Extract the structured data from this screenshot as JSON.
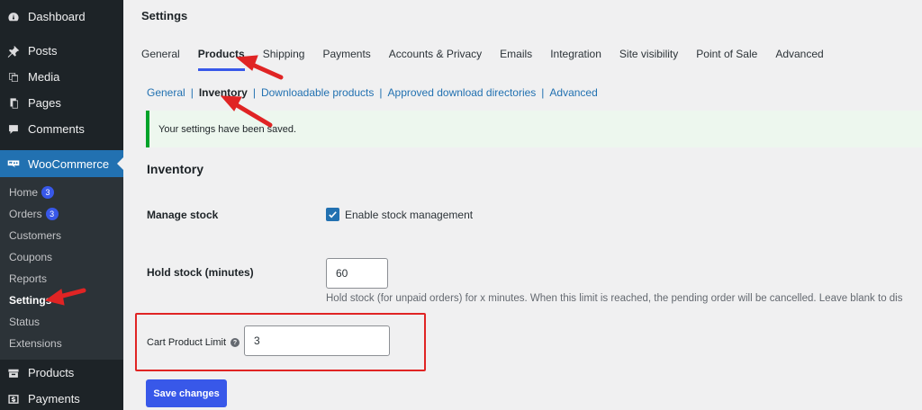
{
  "sidebar": {
    "top_items": [
      {
        "label": "Dashboard",
        "icon": "dashboard-icon"
      },
      {
        "label": "Posts",
        "icon": "pin-icon"
      },
      {
        "label": "Media",
        "icon": "media-icon"
      },
      {
        "label": "Pages",
        "icon": "pages-icon"
      },
      {
        "label": "Comments",
        "icon": "comments-icon"
      }
    ],
    "woocommerce": {
      "label": "WooCommerce",
      "icon": "woocommerce-icon"
    },
    "submenu": [
      {
        "label": "Home",
        "badge": "3"
      },
      {
        "label": "Orders",
        "badge": "3"
      },
      {
        "label": "Customers"
      },
      {
        "label": "Coupons"
      },
      {
        "label": "Reports"
      },
      {
        "label": "Settings",
        "current": true
      },
      {
        "label": "Status"
      },
      {
        "label": "Extensions"
      }
    ],
    "bottom_items": [
      {
        "label": "Products",
        "icon": "products-icon"
      },
      {
        "label": "Payments",
        "icon": "payments-icon"
      }
    ]
  },
  "header": {
    "title": "Settings"
  },
  "tabs": [
    "General",
    "Products",
    "Shipping",
    "Payments",
    "Accounts & Privacy",
    "Emails",
    "Integration",
    "Site visibility",
    "Point of Sale",
    "Advanced"
  ],
  "active_tab": "Products",
  "subnav": {
    "items": [
      "General",
      "Inventory",
      "Downloadable products",
      "Approved download directories",
      "Advanced"
    ],
    "current": "Inventory",
    "separator": "|"
  },
  "notice": {
    "text": "Your settings have been saved."
  },
  "section": {
    "title": "Inventory"
  },
  "fields": {
    "manage_stock": {
      "label": "Manage stock",
      "checkbox_label": "Enable stock management",
      "checked": true
    },
    "hold_stock": {
      "label": "Hold stock (minutes)",
      "value": "60",
      "description": "Hold stock (for unpaid orders) for x minutes. When this limit is reached, the pending order will be cancelled. Leave blank to dis"
    },
    "cart_limit": {
      "label": "Cart Product Limit",
      "help": "?",
      "value": "3"
    }
  },
  "save_button": {
    "label": "Save changes"
  },
  "colors": {
    "sidebar_bg": "#1d2327",
    "accent": "#3858e9",
    "success": "#00a32a",
    "annotation": "#e02424"
  }
}
